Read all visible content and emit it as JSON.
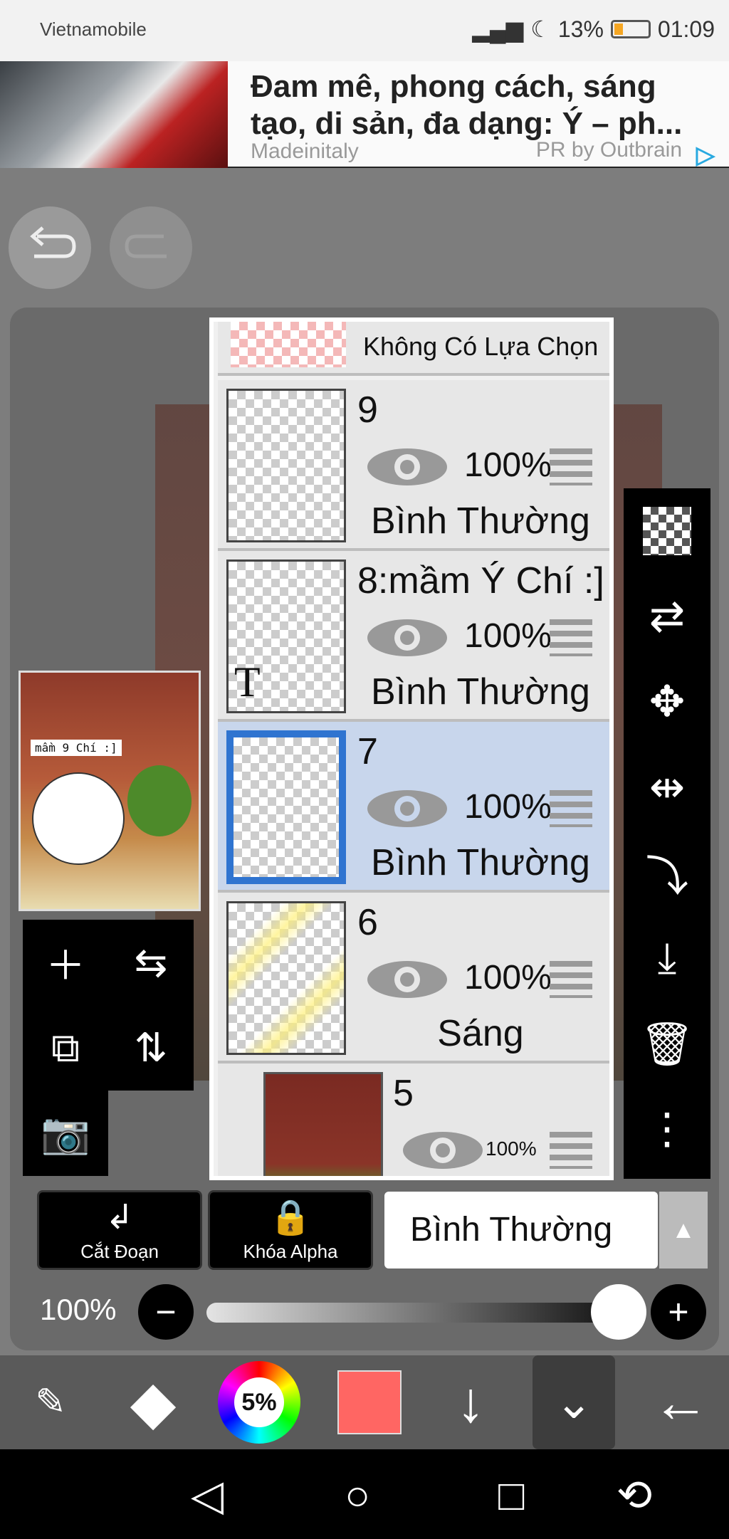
{
  "status": {
    "carrier": "Vietnamobile",
    "battery": "13%",
    "time": "01:09"
  },
  "ad": {
    "title": "Đam mê, phong cách, sáng tạo, di sản, đa dạng: Ý – ph...",
    "source": "Madeinitaly",
    "sponsor": "PR by Outbrain"
  },
  "preview": {
    "caption": "mầm 9 Chí :]"
  },
  "layers": {
    "selection_label": "Không Có Lựa Chọn",
    "items": [
      {
        "name": "9",
        "opacity": "100%",
        "mode": "Bình Thường"
      },
      {
        "name": "8:mầm Ý Chí :]",
        "opacity": "100%",
        "mode": "Bình Thường",
        "thumb_letter": "T"
      },
      {
        "name": "7",
        "opacity": "100%",
        "mode": "Bình Thường"
      },
      {
        "name": "6",
        "opacity": "100%",
        "mode": "Sáng"
      },
      {
        "name": "5",
        "opacity": "100%"
      }
    ]
  },
  "controls": {
    "clip_label": "Cắt Đoạn",
    "alpha_label": "Khóa Alpha",
    "blend_mode": "Bình Thường",
    "opacity": "100%",
    "opacity_value": 1.0
  },
  "toolbar": {
    "brush_size": "5%",
    "current_color": "#ff6663"
  },
  "icons": {
    "undo": "undo-icon",
    "redo": "redo-icon",
    "add": "plus-icon",
    "flip": "flip-horizontal-icon",
    "add_copy": "add-layer-icon",
    "flip_v": "flip-vertical-icon",
    "camera": "camera-icon",
    "checker": "transparency-icon",
    "merge": "swap-layers-icon",
    "move": "move-icon",
    "download": "merge-down-icon",
    "trash": "trash-icon",
    "more": "more-icon"
  }
}
